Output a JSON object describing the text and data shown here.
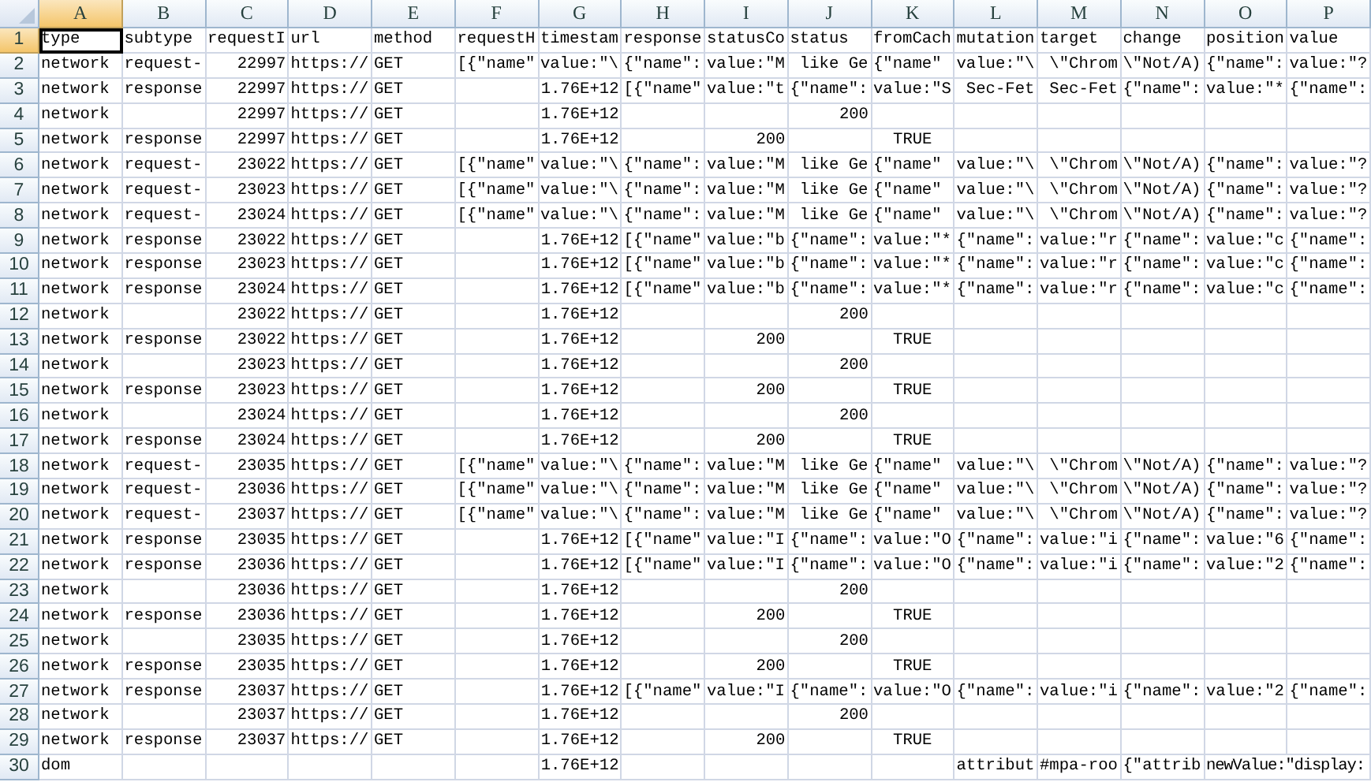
{
  "columns": [
    {
      "label": "A",
      "selected": true
    },
    {
      "label": "B",
      "selected": false
    },
    {
      "label": "C",
      "selected": false
    },
    {
      "label": "D",
      "selected": false
    },
    {
      "label": "E",
      "selected": false
    },
    {
      "label": "F",
      "selected": false
    },
    {
      "label": "G",
      "selected": false
    },
    {
      "label": "H",
      "selected": false
    },
    {
      "label": "I",
      "selected": false
    },
    {
      "label": "J",
      "selected": false
    },
    {
      "label": "K",
      "selected": false
    },
    {
      "label": "L",
      "selected": false
    },
    {
      "label": "M",
      "selected": false
    },
    {
      "label": "N",
      "selected": false
    },
    {
      "label": "O",
      "selected": false
    },
    {
      "label": "P",
      "selected": false
    }
  ],
  "rows": [
    {
      "number": "1",
      "selected": true,
      "cells": [
        "type",
        "subtype",
        "requestI",
        "url",
        "method",
        "requestH",
        "timestam",
        "response",
        "statusCo",
        "status",
        "fromCach",
        "mutation",
        "target",
        "change",
        "position",
        "value"
      ]
    },
    {
      "number": "2",
      "selected": false,
      "cells": [
        "network",
        "request-",
        {
          "text": "22997",
          "kind": "number"
        },
        "https://",
        "GET",
        "[{\"name\"",
        "value:\"\\",
        "{\"name\":",
        "value:\"M",
        " like Ge",
        "{\"name\"",
        "value:\"\\",
        " \\\"Chrom",
        "\\\"Not/A)",
        "{\"name\":",
        "value:\"?"
      ]
    },
    {
      "number": "3",
      "selected": false,
      "cells": [
        "network",
        "response",
        {
          "text": "22997",
          "kind": "number"
        },
        "https://",
        "GET",
        null,
        {
          "text": "1.76E+12",
          "kind": "number"
        },
        "[{\"name\"",
        "value:\"t",
        "{\"name\":",
        "value:\"S",
        " Sec-Fet",
        " Sec-Fet",
        "{\"name\":",
        "value:\"*",
        "{\"name\":"
      ]
    },
    {
      "number": "4",
      "selected": false,
      "cells": [
        "network",
        null,
        {
          "text": "22997",
          "kind": "number"
        },
        "https://",
        "GET",
        null,
        {
          "text": "1.76E+12",
          "kind": "number"
        },
        null,
        null,
        {
          "text": "200",
          "kind": "number"
        }
      ]
    },
    {
      "number": "5",
      "selected": false,
      "cells": [
        "network",
        "response",
        {
          "text": "22997",
          "kind": "number"
        },
        "https://",
        "GET",
        null,
        {
          "text": "1.76E+12",
          "kind": "number"
        },
        null,
        {
          "text": "200",
          "kind": "number"
        },
        null,
        {
          "text": "TRUE",
          "kind": "boolean"
        }
      ]
    },
    {
      "number": "6",
      "selected": false,
      "cells": [
        "network",
        "request-",
        {
          "text": "23022",
          "kind": "number"
        },
        "https://",
        "GET",
        "[{\"name\"",
        "value:\"\\",
        "{\"name\":",
        "value:\"M",
        " like Ge",
        "{\"name\"",
        "value:\"\\",
        " \\\"Chrom",
        "\\\"Not/A)",
        "{\"name\":",
        "value:\"?"
      ]
    },
    {
      "number": "7",
      "selected": false,
      "cells": [
        "network",
        "request-",
        {
          "text": "23023",
          "kind": "number"
        },
        "https://",
        "GET",
        "[{\"name\"",
        "value:\"\\",
        "{\"name\":",
        "value:\"M",
        " like Ge",
        "{\"name\"",
        "value:\"\\",
        " \\\"Chrom",
        "\\\"Not/A)",
        "{\"name\":",
        "value:\"?"
      ]
    },
    {
      "number": "8",
      "selected": false,
      "cells": [
        "network",
        "request-",
        {
          "text": "23024",
          "kind": "number"
        },
        "https://",
        "GET",
        "[{\"name\"",
        "value:\"\\",
        "{\"name\":",
        "value:\"M",
        " like Ge",
        "{\"name\"",
        "value:\"\\",
        " \\\"Chrom",
        "\\\"Not/A)",
        "{\"name\":",
        "value:\"?"
      ]
    },
    {
      "number": "9",
      "selected": false,
      "cells": [
        "network",
        "response",
        {
          "text": "23022",
          "kind": "number"
        },
        "https://",
        "GET",
        null,
        {
          "text": "1.76E+12",
          "kind": "number"
        },
        "[{\"name\"",
        "value:\"b",
        "{\"name\":",
        "value:\"*",
        "{\"name\":",
        "value:\"r",
        "{\"name\":",
        "value:\"c",
        "{\"name\":"
      ]
    },
    {
      "number": "10",
      "selected": false,
      "cells": [
        "network",
        "response",
        {
          "text": "23023",
          "kind": "number"
        },
        "https://",
        "GET",
        null,
        {
          "text": "1.76E+12",
          "kind": "number"
        },
        "[{\"name\"",
        "value:\"b",
        "{\"name\":",
        "value:\"*",
        "{\"name\":",
        "value:\"r",
        "{\"name\":",
        "value:\"c",
        "{\"name\":"
      ]
    },
    {
      "number": "11",
      "selected": false,
      "cells": [
        "network",
        "response",
        {
          "text": "23024",
          "kind": "number"
        },
        "https://",
        "GET",
        null,
        {
          "text": "1.76E+12",
          "kind": "number"
        },
        "[{\"name\"",
        "value:\"b",
        "{\"name\":",
        "value:\"*",
        "{\"name\":",
        "value:\"r",
        "{\"name\":",
        "value:\"c",
        "{\"name\":"
      ]
    },
    {
      "number": "12",
      "selected": false,
      "cells": [
        "network",
        null,
        {
          "text": "23022",
          "kind": "number"
        },
        "https://",
        "GET",
        null,
        {
          "text": "1.76E+12",
          "kind": "number"
        },
        null,
        null,
        {
          "text": "200",
          "kind": "number"
        }
      ]
    },
    {
      "number": "13",
      "selected": false,
      "cells": [
        "network",
        "response",
        {
          "text": "23022",
          "kind": "number"
        },
        "https://",
        "GET",
        null,
        {
          "text": "1.76E+12",
          "kind": "number"
        },
        null,
        {
          "text": "200",
          "kind": "number"
        },
        null,
        {
          "text": "TRUE",
          "kind": "boolean"
        }
      ]
    },
    {
      "number": "14",
      "selected": false,
      "cells": [
        "network",
        null,
        {
          "text": "23023",
          "kind": "number"
        },
        "https://",
        "GET",
        null,
        {
          "text": "1.76E+12",
          "kind": "number"
        },
        null,
        null,
        {
          "text": "200",
          "kind": "number"
        }
      ]
    },
    {
      "number": "15",
      "selected": false,
      "cells": [
        "network",
        "response",
        {
          "text": "23023",
          "kind": "number"
        },
        "https://",
        "GET",
        null,
        {
          "text": "1.76E+12",
          "kind": "number"
        },
        null,
        {
          "text": "200",
          "kind": "number"
        },
        null,
        {
          "text": "TRUE",
          "kind": "boolean"
        }
      ]
    },
    {
      "number": "16",
      "selected": false,
      "cells": [
        "network",
        null,
        {
          "text": "23024",
          "kind": "number"
        },
        "https://",
        "GET",
        null,
        {
          "text": "1.76E+12",
          "kind": "number"
        },
        null,
        null,
        {
          "text": "200",
          "kind": "number"
        }
      ]
    },
    {
      "number": "17",
      "selected": false,
      "cells": [
        "network",
        "response",
        {
          "text": "23024",
          "kind": "number"
        },
        "https://",
        "GET",
        null,
        {
          "text": "1.76E+12",
          "kind": "number"
        },
        null,
        {
          "text": "200",
          "kind": "number"
        },
        null,
        {
          "text": "TRUE",
          "kind": "boolean"
        }
      ]
    },
    {
      "number": "18",
      "selected": false,
      "cells": [
        "network",
        "request-",
        {
          "text": "23035",
          "kind": "number"
        },
        "https://",
        "GET",
        "[{\"name\"",
        "value:\"\\",
        "{\"name\":",
        "value:\"M",
        " like Ge",
        "{\"name\"",
        "value:\"\\",
        " \\\"Chrom",
        "\\\"Not/A)",
        "{\"name\":",
        "value:\"?"
      ]
    },
    {
      "number": "19",
      "selected": false,
      "cells": [
        "network",
        "request-",
        {
          "text": "23036",
          "kind": "number"
        },
        "https://",
        "GET",
        "[{\"name\"",
        "value:\"\\",
        "{\"name\":",
        "value:\"M",
        " like Ge",
        "{\"name\"",
        "value:\"\\",
        " \\\"Chrom",
        "\\\"Not/A)",
        "{\"name\":",
        "value:\"?"
      ]
    },
    {
      "number": "20",
      "selected": false,
      "cells": [
        "network",
        "request-",
        {
          "text": "23037",
          "kind": "number"
        },
        "https://",
        "GET",
        "[{\"name\"",
        "value:\"\\",
        "{\"name\":",
        "value:\"M",
        " like Ge",
        "{\"name\"",
        "value:\"\\",
        " \\\"Chrom",
        "\\\"Not/A)",
        "{\"name\":",
        "value:\"?"
      ]
    },
    {
      "number": "21",
      "selected": false,
      "cells": [
        "network",
        "response",
        {
          "text": "23035",
          "kind": "number"
        },
        "https://",
        "GET",
        null,
        {
          "text": "1.76E+12",
          "kind": "number"
        },
        "[{\"name\"",
        "value:\"I",
        "{\"name\":",
        "value:\"O",
        "{\"name\":",
        "value:\"i",
        "{\"name\":",
        "value:\"6",
        "{\"name\":"
      ]
    },
    {
      "number": "22",
      "selected": false,
      "cells": [
        "network",
        "response",
        {
          "text": "23036",
          "kind": "number"
        },
        "https://",
        "GET",
        null,
        {
          "text": "1.76E+12",
          "kind": "number"
        },
        "[{\"name\"",
        "value:\"I",
        "{\"name\":",
        "value:\"O",
        "{\"name\":",
        "value:\"i",
        "{\"name\":",
        "value:\"2",
        "{\"name\":"
      ]
    },
    {
      "number": "23",
      "selected": false,
      "cells": [
        "network",
        null,
        {
          "text": "23036",
          "kind": "number"
        },
        "https://",
        "GET",
        null,
        {
          "text": "1.76E+12",
          "kind": "number"
        },
        null,
        null,
        {
          "text": "200",
          "kind": "number"
        }
      ]
    },
    {
      "number": "24",
      "selected": false,
      "cells": [
        "network",
        "response",
        {
          "text": "23036",
          "kind": "number"
        },
        "https://",
        "GET",
        null,
        {
          "text": "1.76E+12",
          "kind": "number"
        },
        null,
        {
          "text": "200",
          "kind": "number"
        },
        null,
        {
          "text": "TRUE",
          "kind": "boolean"
        }
      ]
    },
    {
      "number": "25",
      "selected": false,
      "cells": [
        "network",
        null,
        {
          "text": "23035",
          "kind": "number"
        },
        "https://",
        "GET",
        null,
        {
          "text": "1.76E+12",
          "kind": "number"
        },
        null,
        null,
        {
          "text": "200",
          "kind": "number"
        }
      ]
    },
    {
      "number": "26",
      "selected": false,
      "cells": [
        "network",
        "response",
        {
          "text": "23035",
          "kind": "number"
        },
        "https://",
        "GET",
        null,
        {
          "text": "1.76E+12",
          "kind": "number"
        },
        null,
        {
          "text": "200",
          "kind": "number"
        },
        null,
        {
          "text": "TRUE",
          "kind": "boolean"
        }
      ]
    },
    {
      "number": "27",
      "selected": false,
      "cells": [
        "network",
        "response",
        {
          "text": "23037",
          "kind": "number"
        },
        "https://",
        "GET",
        null,
        {
          "text": "1.76E+12",
          "kind": "number"
        },
        "[{\"name\"",
        "value:\"I",
        "{\"name\":",
        "value:\"O",
        "{\"name\":",
        "value:\"i",
        "{\"name\":",
        "value:\"2",
        "{\"name\":"
      ]
    },
    {
      "number": "28",
      "selected": false,
      "cells": [
        "network",
        null,
        {
          "text": "23037",
          "kind": "number"
        },
        "https://",
        "GET",
        null,
        {
          "text": "1.76E+12",
          "kind": "number"
        },
        null,
        null,
        {
          "text": "200",
          "kind": "number"
        }
      ]
    },
    {
      "number": "29",
      "selected": false,
      "cells": [
        "network",
        "response",
        {
          "text": "23037",
          "kind": "number"
        },
        "https://",
        "GET",
        null,
        {
          "text": "1.76E+12",
          "kind": "number"
        },
        null,
        {
          "text": "200",
          "kind": "number"
        },
        null,
        {
          "text": "TRUE",
          "kind": "boolean"
        }
      ]
    },
    {
      "number": "30",
      "selected": false,
      "cells": [
        "dom",
        null,
        null,
        null,
        null,
        null,
        {
          "text": "1.76E+12",
          "kind": "number"
        },
        null,
        null,
        null,
        null,
        "attribut",
        "#mpa-roo",
        "{\"attrib",
        "newValue:\"display:"
      ]
    }
  ]
}
